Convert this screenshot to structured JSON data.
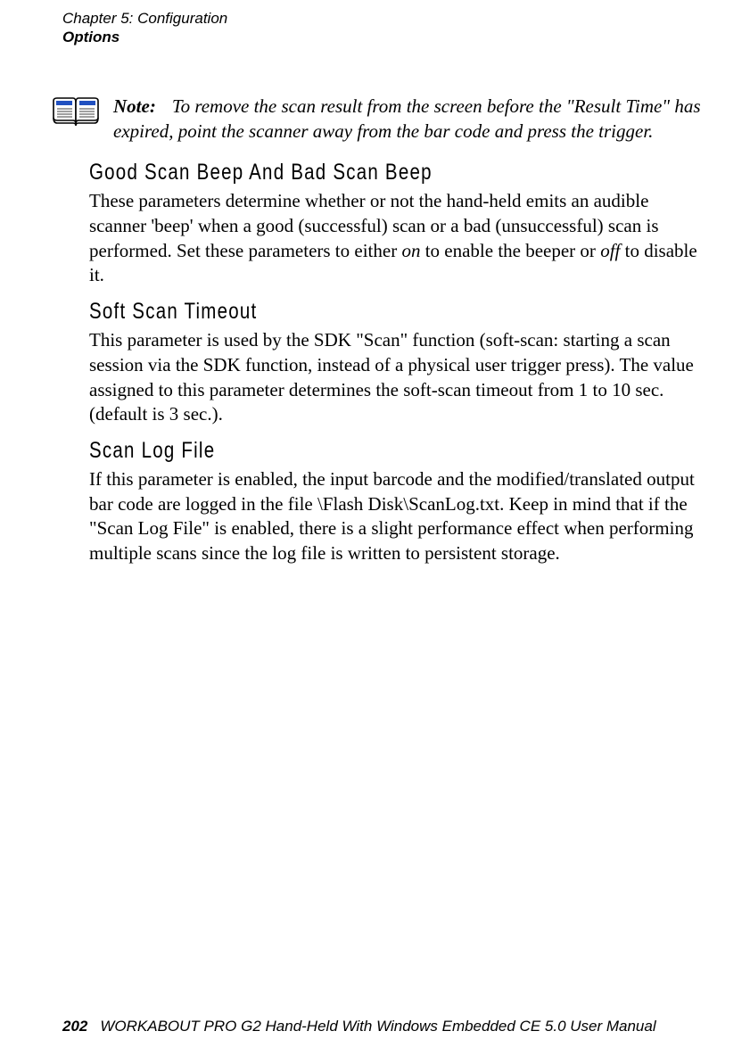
{
  "header": {
    "chapter": "Chapter 5: Configuration",
    "section": "Options"
  },
  "note": {
    "label": "Note:",
    "body": "To remove the scan result from the screen before the \"Result Time\" has expired, point the scanner away from the bar code and press the trigger."
  },
  "sections": {
    "goodBeep": {
      "heading": "Good Scan Beep And Bad Scan Beep",
      "body_pre": "These parameters determine whether or not the hand-held emits an audible scanner 'beep' when a good (successful) scan or a bad (unsuccessful) scan is performed. Set these parameters to either ",
      "em1": "on",
      "body_mid": " to enable the beeper or ",
      "em2": "off",
      "body_post": " to disable it."
    },
    "softScan": {
      "heading": "Soft Scan Timeout",
      "body": "This parameter is used by the SDK \"Scan\" function (soft-scan: starting a scan session via the SDK function, instead of a physical user trigger press). The value assigned to this parameter determines the soft-scan timeout from 1 to 10 sec. (default is 3 sec.)."
    },
    "scanLog": {
      "heading": "Scan Log File",
      "body": "If this parameter is enabled, the input barcode and the modified/translated output bar code are logged in the file \\Flash Disk\\ScanLog.txt. Keep in mind that if the \"Scan Log File\" is enabled, there is a slight performance effect when performing multiple scans since the log file is written to persistent storage."
    }
  },
  "footer": {
    "pageNumber": "202",
    "title": "WORKABOUT PRO G2 Hand-Held With Windows Embedded CE 5.0 User Manual"
  }
}
